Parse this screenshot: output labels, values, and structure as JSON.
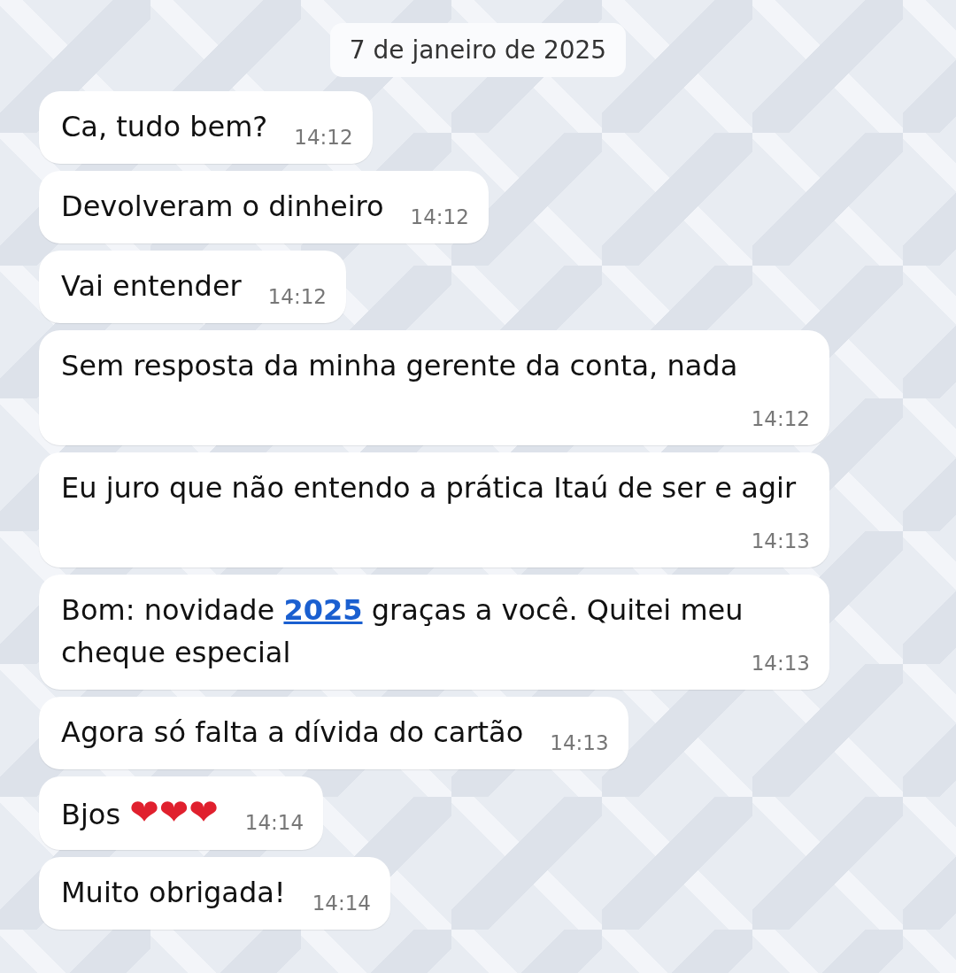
{
  "date_label": "7 de janeiro de 2025",
  "messages": [
    {
      "time": "14:12",
      "segments": [
        {
          "kind": "text",
          "text": "Ca, tudo bem?"
        }
      ]
    },
    {
      "time": "14:12",
      "segments": [
        {
          "kind": "text",
          "text": "Devolveram o dinheiro"
        }
      ]
    },
    {
      "time": "14:12",
      "segments": [
        {
          "kind": "text",
          "text": "Vai entender"
        }
      ]
    },
    {
      "time": "14:12",
      "segments": [
        {
          "kind": "text",
          "text": "Sem resposta  da minha gerente da conta, nada"
        }
      ]
    },
    {
      "time": "14:13",
      "segments": [
        {
          "kind": "text",
          "text": "Eu juro que não entendo a prática Itaú de ser e agir"
        }
      ]
    },
    {
      "time": "14:13",
      "segments": [
        {
          "kind": "text",
          "text": "Bom: novidade "
        },
        {
          "kind": "link",
          "text": "2025"
        },
        {
          "kind": "text",
          "text": " graças a você. Quitei meu cheque especial"
        }
      ]
    },
    {
      "time": "14:13",
      "segments": [
        {
          "kind": "text",
          "text": "Agora só falta a dívida do cartão"
        }
      ]
    },
    {
      "time": "14:14",
      "segments": [
        {
          "kind": "text",
          "text": "Bjos "
        },
        {
          "kind": "emoji",
          "text": "❤❤❤"
        }
      ]
    },
    {
      "time": "14:14",
      "segments": [
        {
          "kind": "text",
          "text": "Muito obrigada!"
        }
      ]
    }
  ]
}
